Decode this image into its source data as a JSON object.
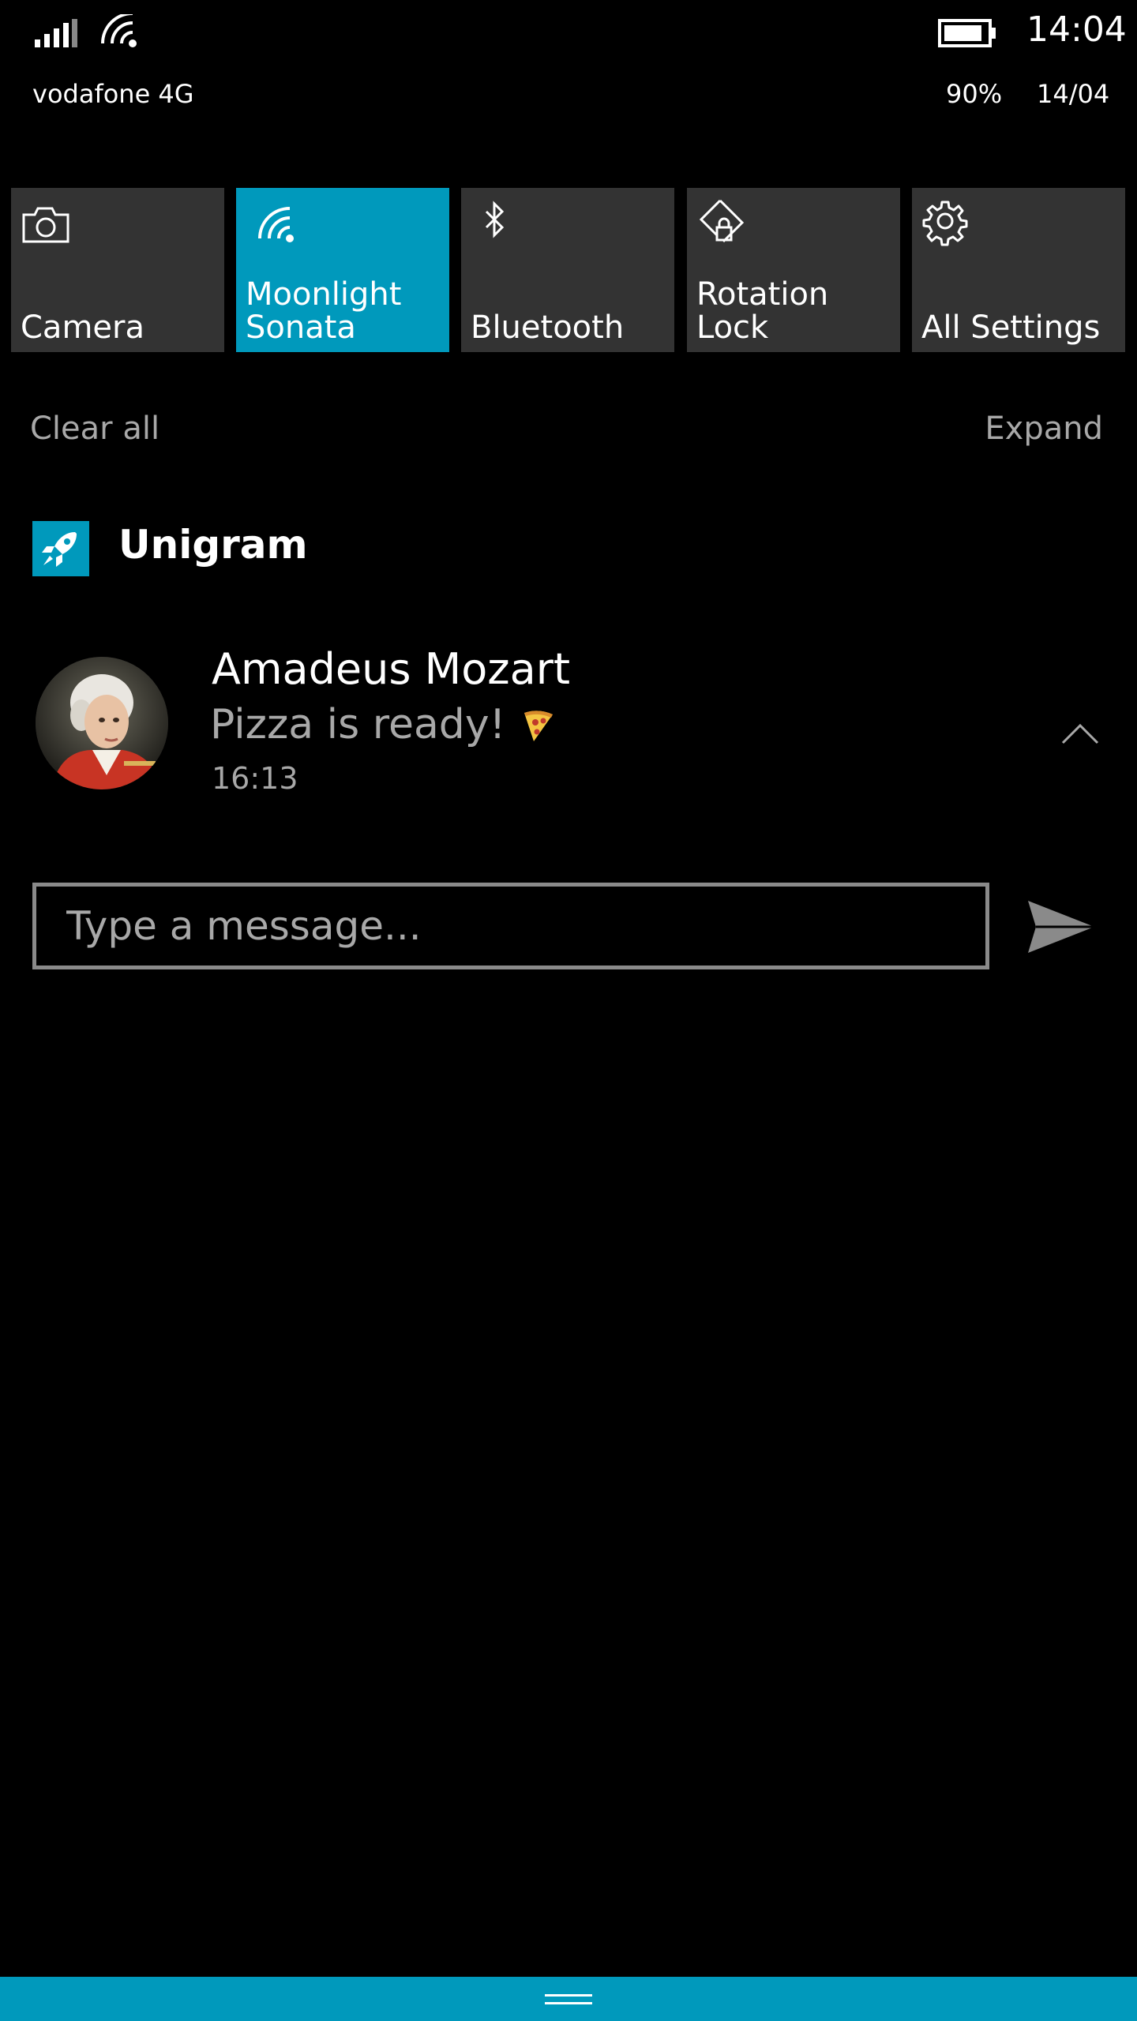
{
  "status_bar": {
    "carrier": "vodafone 4G",
    "time": "14:04",
    "battery_percent": "90%",
    "date": "14/04",
    "signal_icon": "signal-bars-icon",
    "wifi_icon": "wifi-icon",
    "battery_icon": "battery-icon",
    "battery_level": 0.9
  },
  "quick_actions": [
    {
      "label": "Camera",
      "icon": "camera-icon",
      "active": false
    },
    {
      "label": "Moonlight\nSonata",
      "icon": "wifi-icon",
      "active": true
    },
    {
      "label": "Bluetooth",
      "icon": "bluetooth-icon",
      "active": false
    },
    {
      "label": "Rotation Lock",
      "icon": "rotation-lock-icon",
      "active": false
    },
    {
      "label": "All Settings",
      "icon": "gear-icon",
      "active": false
    }
  ],
  "actions": {
    "clear_all": "Clear all",
    "expand": "Expand"
  },
  "notification": {
    "app_name": "Unigram",
    "app_icon": "rocket-icon",
    "sender": "Amadeus Mozart",
    "message": "Pizza is ready!",
    "emoji_icon": "pizza-icon",
    "time": "16:13",
    "reply": {
      "placeholder": "Type a message...",
      "value": ""
    }
  },
  "colors": {
    "accent": "#0099bc",
    "tile": "#333333",
    "secondary_text": "#a8a8a8",
    "background": "#000000"
  }
}
